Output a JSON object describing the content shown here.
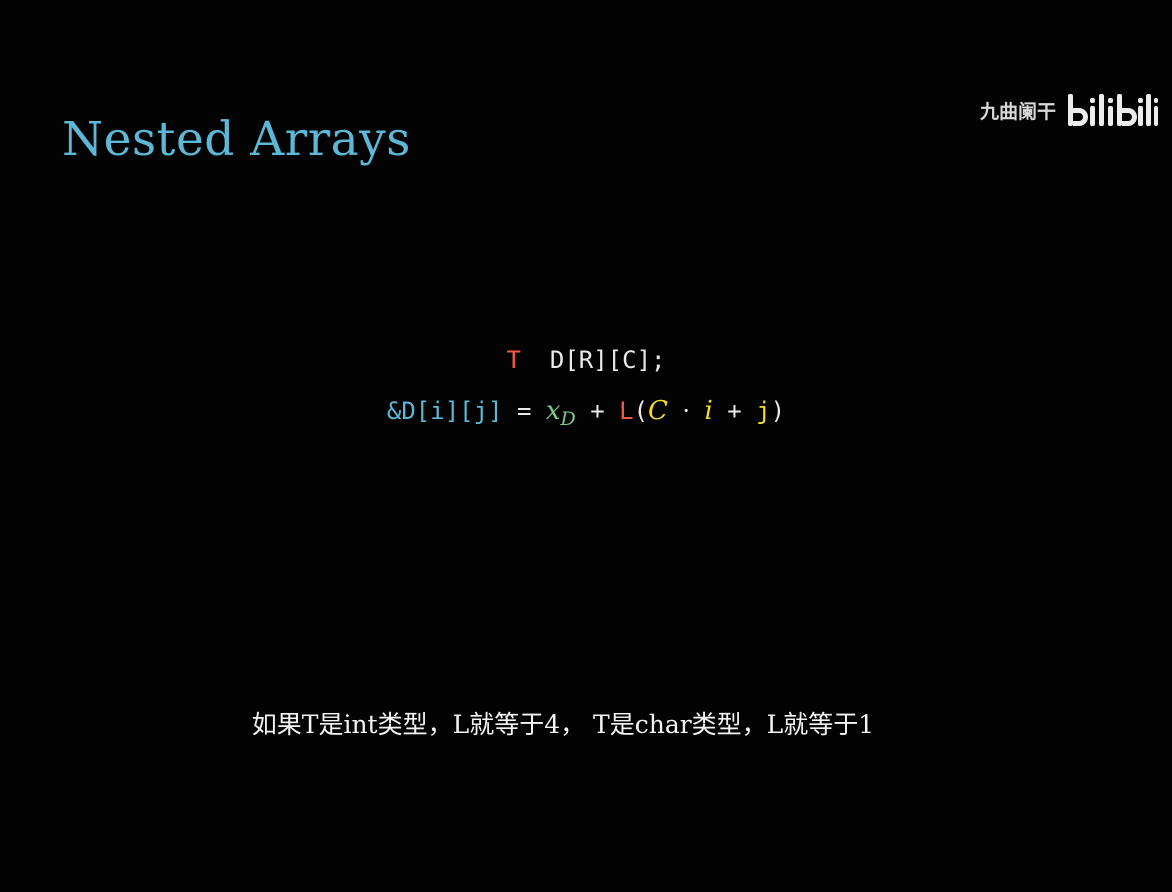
{
  "slide": {
    "title": "Nested Arrays"
  },
  "watermark": {
    "author": "九曲阑干",
    "logo_text": "bilibili",
    "logo_icon": "bilibili-logo"
  },
  "code": {
    "line1": {
      "type": "T",
      "declaration": "D[R][C];"
    },
    "line2": {
      "address": "&D[i][j]",
      "equals": "=",
      "base_var": "x",
      "base_sub": "D",
      "plus1": "+",
      "size_fn": "L",
      "open_paren": "(",
      "row_len": "C",
      "dot": "·",
      "row_idx": "i",
      "plus2": "+",
      "col_idx": "j",
      "close_paren": ")"
    }
  },
  "subtitle": {
    "text": "如果T是int类型，L就等于4， T是char类型，L就等于1"
  },
  "colors": {
    "background": "#030303",
    "title": "#5cb8d6",
    "type_red": "#ef5a44",
    "address_blue": "#5cb8d6",
    "base_green": "#7ec98e",
    "index_yellow": "#f2dc2e",
    "text_white": "#eaeaea"
  }
}
